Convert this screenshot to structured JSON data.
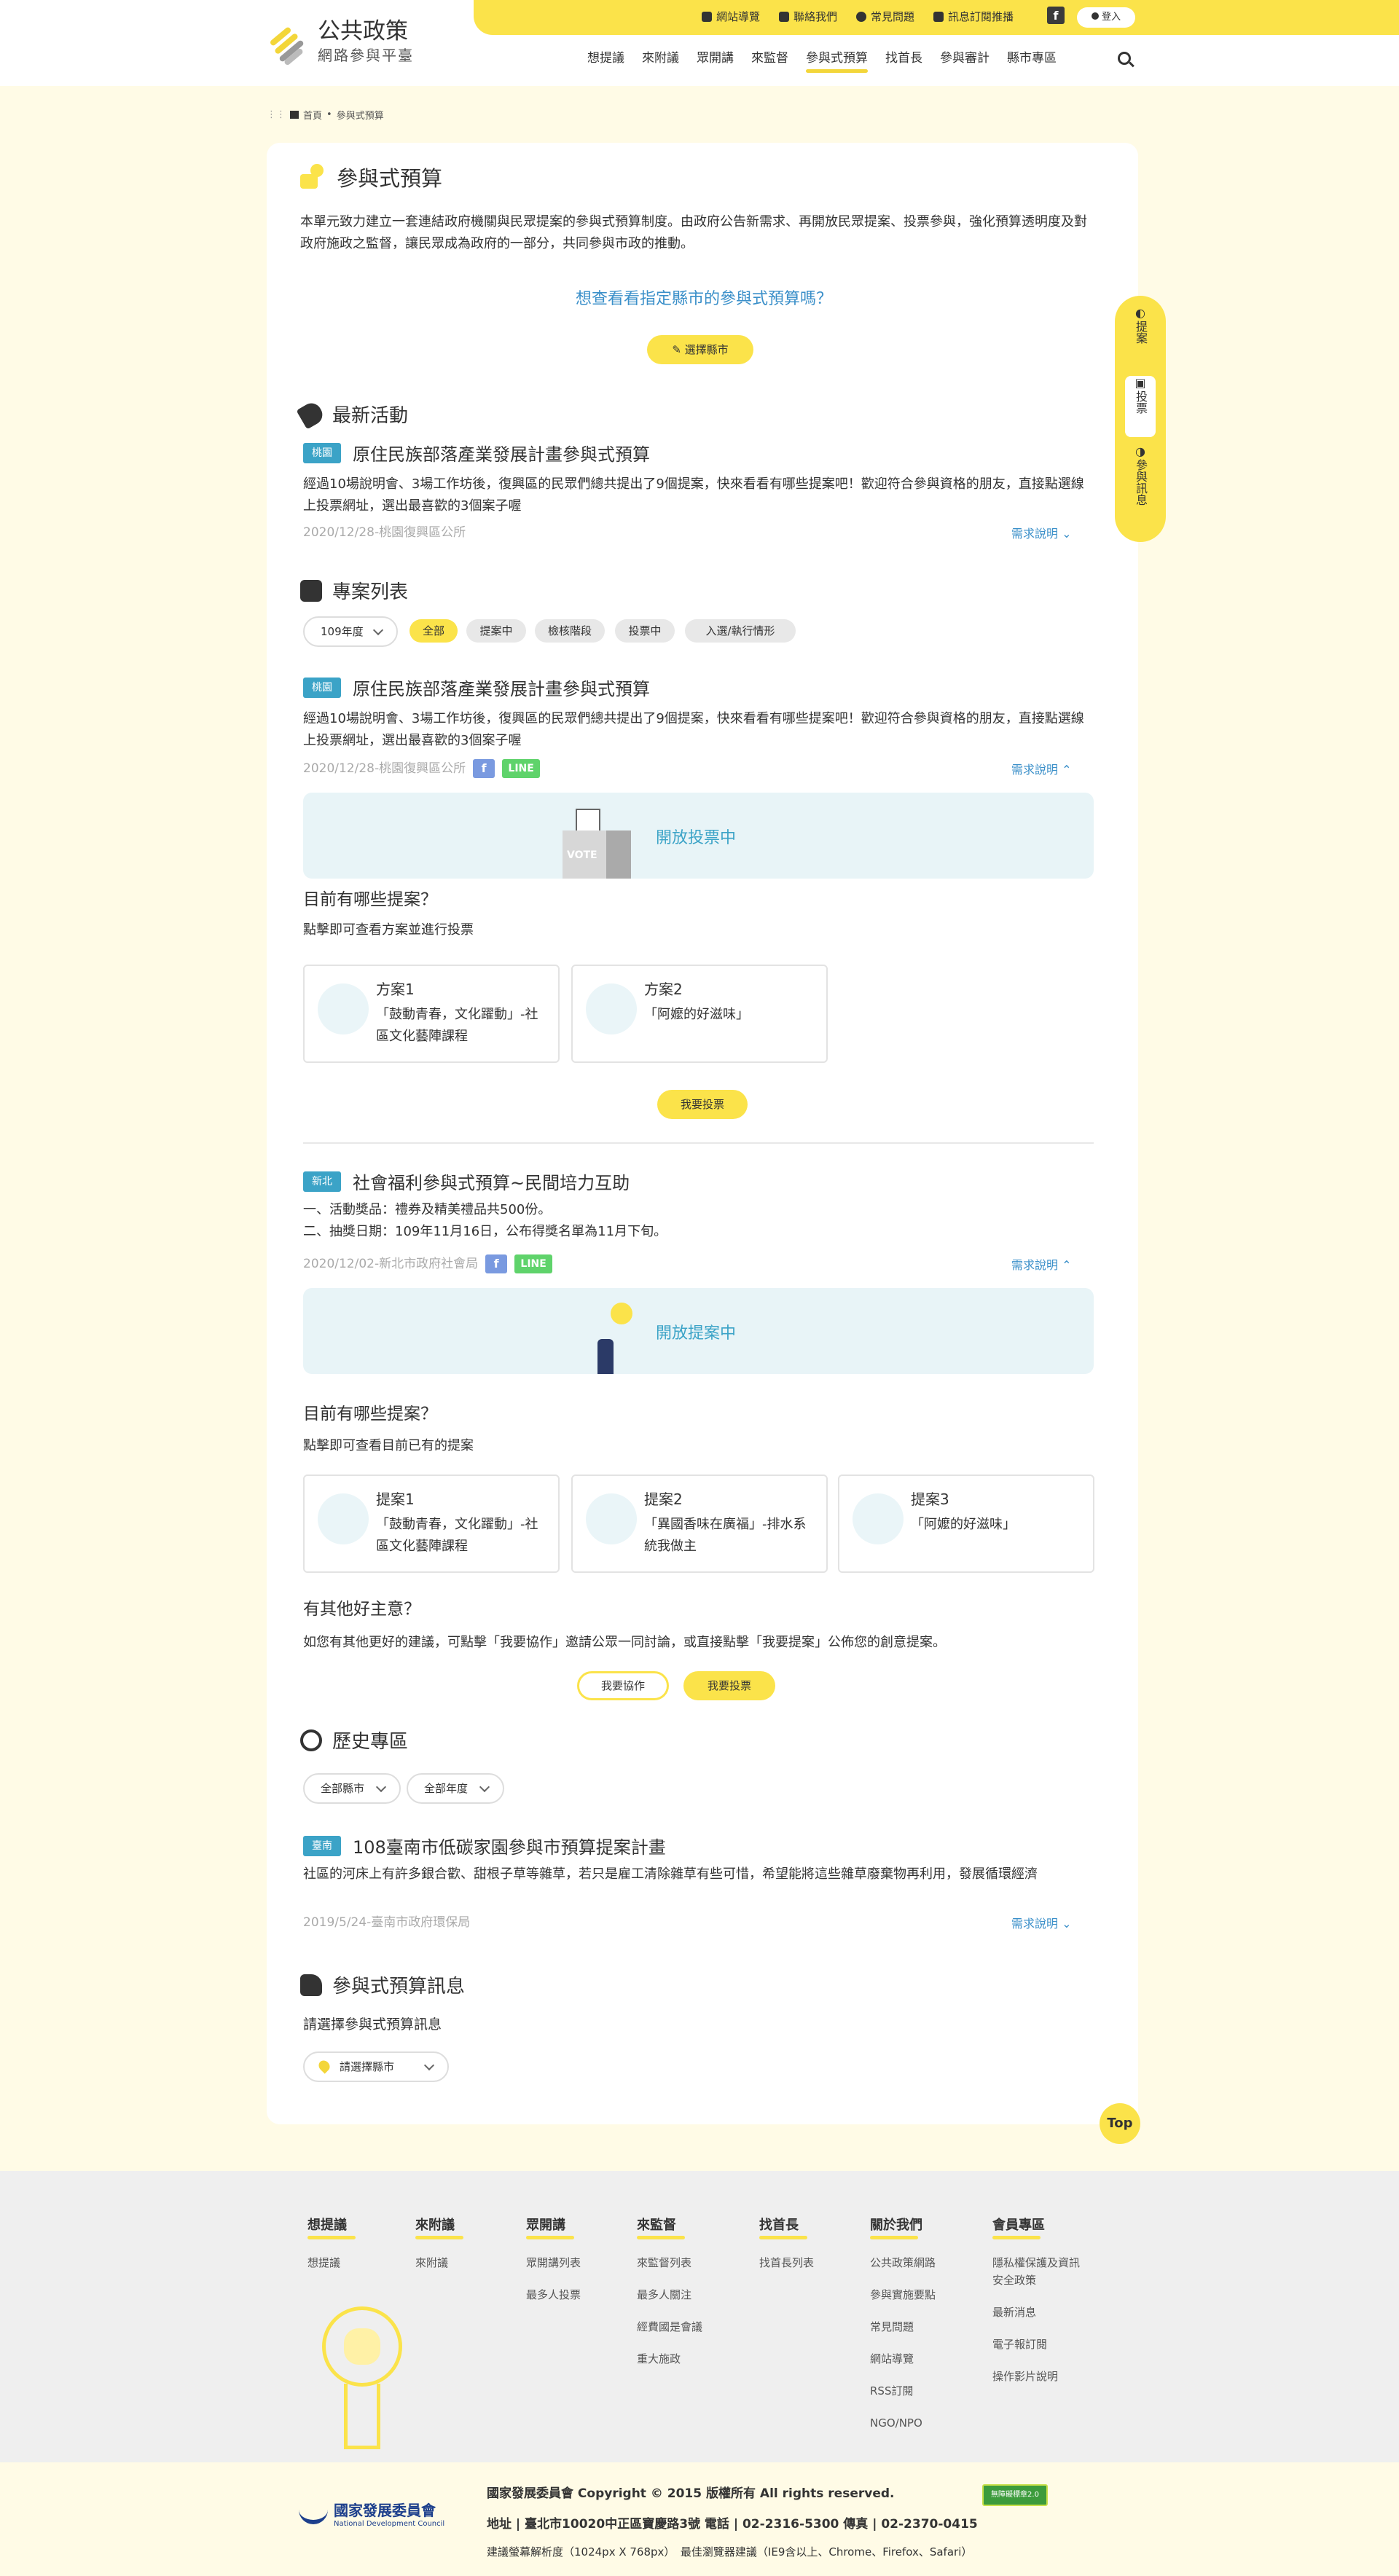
{
  "header": {
    "logo_title": "公共政策",
    "logo_sub": "網路參與平臺",
    "top_links": [
      "網站導覽",
      "聯絡我們",
      "常見問題",
      "訊息訂閱推播"
    ],
    "facebook": "f",
    "login": "登入",
    "nav": [
      "想提議",
      "來附議",
      "眾開講",
      "來監督",
      "參與式預算",
      "找首長",
      "參與審計",
      "縣市專區"
    ]
  },
  "breadcrumb": {
    "home": "首頁",
    "sep": "•",
    "current": "參與式預算"
  },
  "intro": {
    "title": "參與式預算",
    "desc": "本單元致力建立一套連結政府機關與民眾提案的參與式預算制度。由政府公告新需求、再開放民眾提案、投票參與，強化預算透明度及對政府施政之監督，讓民眾成為政府的一部分，共同參與市政的推動。",
    "question": "想查看看指定縣市的參與式預算嗎？",
    "select_city_btn": "選擇縣市"
  },
  "side_nav": {
    "item1": "提案",
    "item2": "投票",
    "item3": "參與訊息"
  },
  "latest": {
    "title": "最新活動",
    "tag": "桃園",
    "item_title": "原住民族部落產業發展計畫參與式預算",
    "desc": "經過10場說明會、3場工作坊後，復興區的民眾們總共提出了9個提案，快來看看有哪些提案吧！歡迎符合參與資格的朋友，直接點選線上投票網址，選出最喜歡的3個案子喔",
    "meta": "2020/12/28-桃園復興區公所",
    "more": "需求說明"
  },
  "projects": {
    "title": "專案列表",
    "year_select": "109年度",
    "filters": [
      "全部",
      "提案中",
      "檢核階段",
      "投票中",
      "入選/執行情形"
    ],
    "item1": {
      "tag": "桃園",
      "title": "原住民族部落產業發展計畫參與式預算",
      "desc": "經過10場說明會、3場工作坊後，復興區的民眾們總共提出了9個提案，快來看看有哪些提案吧！歡迎符合參與資格的朋友，直接點選線上投票網址，選出最喜歡的3個案子喔",
      "meta": "2020/12/28-桃園復興區公所",
      "fb": "f",
      "line": "LINE",
      "more": "需求說明",
      "banner": "開放投票中",
      "vote_label": "VOTE",
      "q_title": "目前有哪些提案？",
      "q_sub": "點擊即可查看方案並進行投票",
      "cards": [
        {
          "title": "方案1",
          "desc": "「鼓動青春，文化躍動」-社區文化藝陣課程"
        },
        {
          "title": "方案2",
          "desc": "「阿嬤的好滋味」"
        }
      ],
      "vote_btn": "我要投票"
    },
    "item2": {
      "tag": "新北",
      "title": "社會福利參與式預算~民間培力互助",
      "line1": "一、活動獎品：禮券及精美禮品共500份。",
      "line2": "二、抽獎日期：109年11月16日，公布得獎名單為11月下旬。",
      "meta": "2020/12/02-新北市政府社會局",
      "fb": "f",
      "line": "LINE",
      "more": "需求說明",
      "banner": "開放提案中",
      "q_title": "目前有哪些提案？",
      "q_sub": "點擊即可查看目前已有的提案",
      "cards": [
        {
          "title": "提案1",
          "desc": "「鼓動青春，文化躍動」-社區文化藝陣課程"
        },
        {
          "title": "提案2",
          "desc": "「異國香味在廣福」-排水系統我做主"
        },
        {
          "title": "提案3",
          "desc": "「阿嬤的好滋味」"
        }
      ],
      "idea_title": "有其他好主意？",
      "idea_desc": "如您有其他更好的建議，可點擊「我要協作」邀請公眾一同討論，或直接點擊「我要提案」公佈您的創意提案。",
      "collab_btn": "我要協作",
      "vote_btn": "我要投票"
    }
  },
  "history": {
    "title": "歷史專區",
    "city_select": "全部縣市",
    "year_select": "全部年度",
    "tag": "臺南",
    "item_title": "108臺南市低碳家園參與市預算提案計畫",
    "desc": "社區的河床上有許多銀合歡、甜根子草等雜草，若只是雇工清除雜草有些可惜，希望能將這些雜草廢棄物再利用，發展循環經濟",
    "meta": "2019/5/24-臺南市政府環保局",
    "more": "需求說明"
  },
  "info": {
    "title": "參與式預算訊息",
    "sub": "請選擇參與式預算訊息",
    "select": "請選擇縣市"
  },
  "top_btn": "Top",
  "footer": {
    "cols": [
      {
        "head": "想提議",
        "links": [
          "想提議"
        ]
      },
      {
        "head": "來附議",
        "links": [
          "來附議"
        ]
      },
      {
        "head": "眾開講",
        "links": [
          "眾開講列表",
          "最多人投票"
        ]
      },
      {
        "head": "來監督",
        "links": [
          "來監督列表",
          "最多人關注",
          "經費國是會議",
          "重大施政"
        ]
      },
      {
        "head": "找首長",
        "links": [
          "找首長列表"
        ]
      },
      {
        "head": "關於我們",
        "links": [
          "公共政策網路",
          "參與實施要點",
          "常見問題",
          "網站導覽",
          "RSS訂閱",
          "NGO/NPO"
        ]
      },
      {
        "head": "會員專區",
        "links": [
          "隱私權保護及資訊安全政策",
          "最新消息",
          "電子報訂閱",
          "操作影片說明"
        ]
      }
    ],
    "org_cn": "國家發展委員會",
    "org_en": "National Development Council",
    "copyright": "國家發展委員會 Copyright © 2015 版權所有 All rights reserved.",
    "address": "地址 | 臺北市10020中正區寶慶路3號 電話 | 02-2316-5300 傳真 | 02-2370-0415",
    "browser": "建議螢幕解析度（1024px X 768px）　最佳瀏覽器建議（IE9含以上、Chrome、Firefox、Safari）",
    "badge": "無障礙標章2.0"
  },
  "colors": {
    "accent": "#fbe34a",
    "tag": "#3ba3c7",
    "link": "#3a8fc9",
    "page_bg": "#fffbe6"
  }
}
